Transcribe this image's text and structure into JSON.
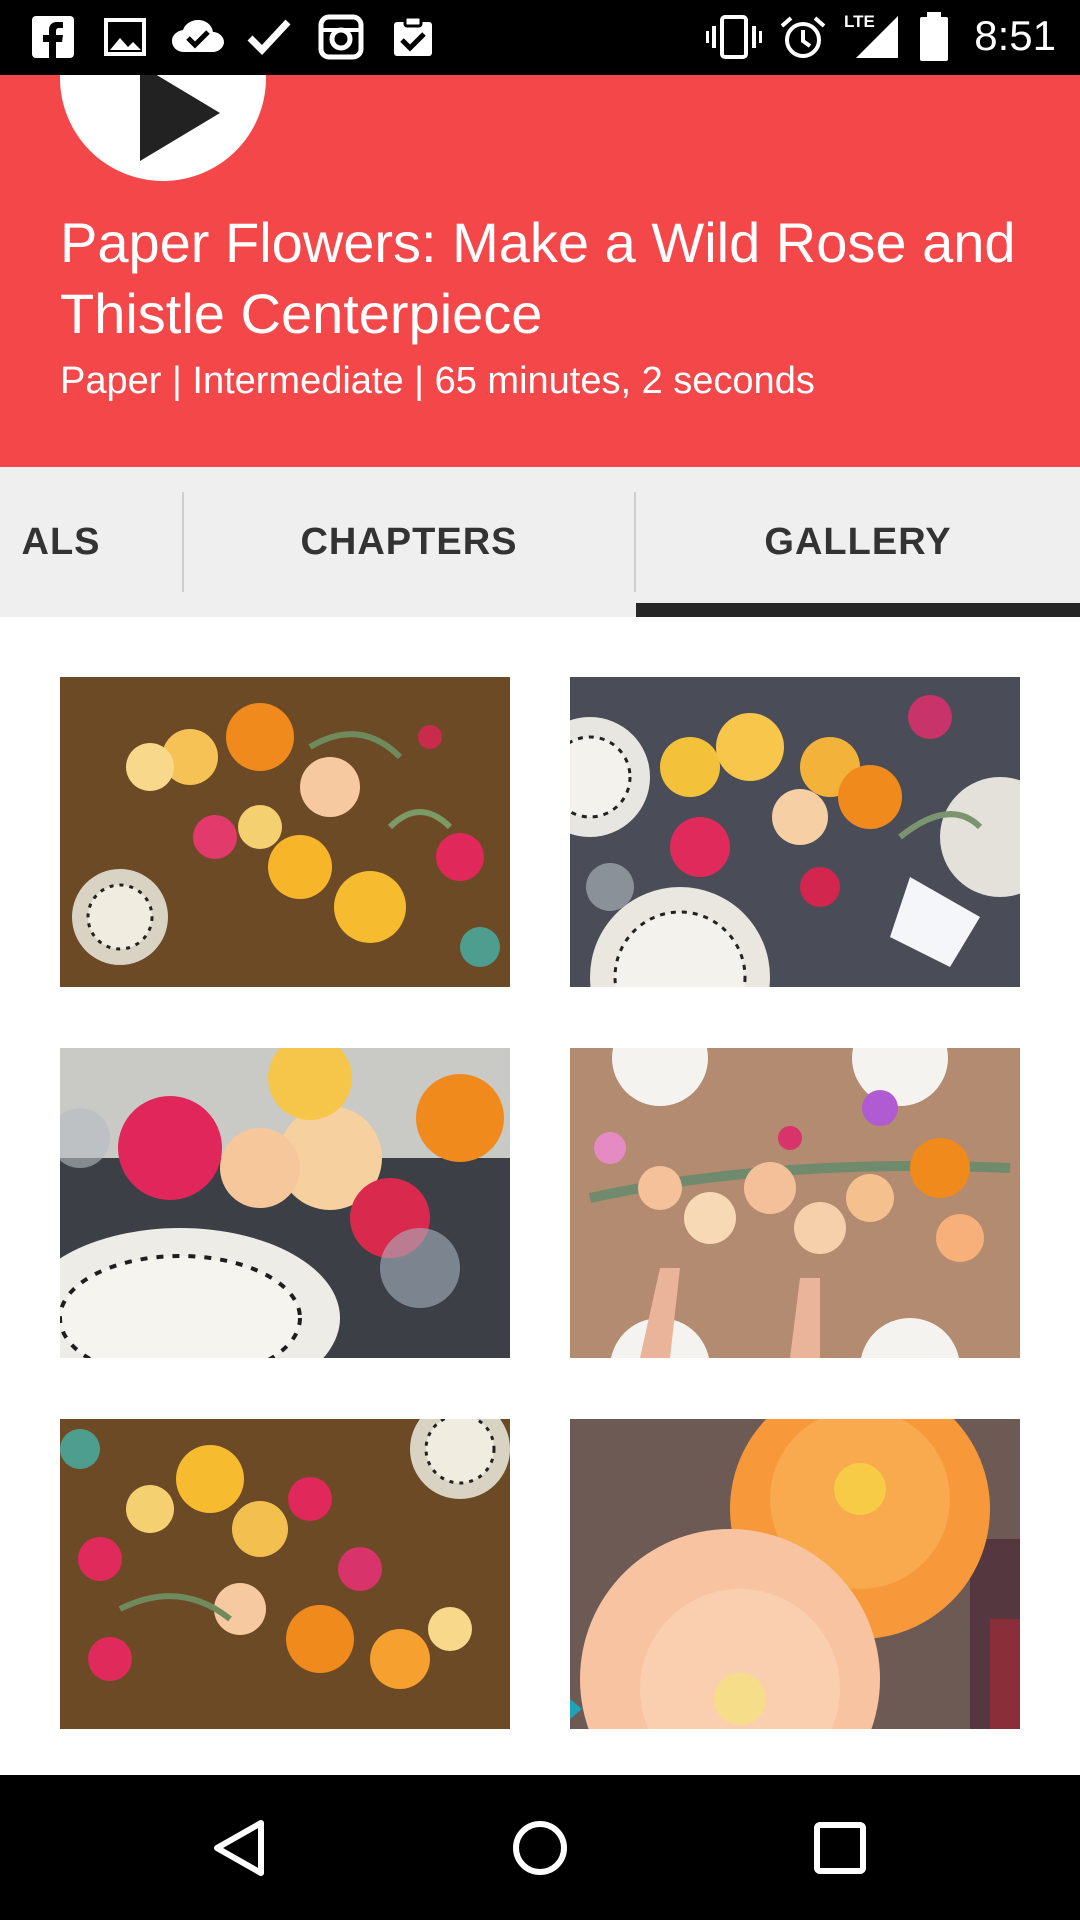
{
  "status_bar": {
    "time": "8:51",
    "left_icons": [
      "facebook-icon",
      "image-icon",
      "cloud-check-icon",
      "check-icon",
      "instagram-icon",
      "clipboard-check-icon"
    ],
    "right_icons": [
      "vibrate-icon",
      "alarm-icon",
      "lte-signal-icon",
      "battery-icon"
    ],
    "network_label": "LTE"
  },
  "header": {
    "title": "Paper Flowers: Make a Wild Rose and Thistle Centerpiece",
    "meta": "Paper | Intermediate | 65 minutes, 2 seconds",
    "background_color": "#f4474a"
  },
  "tabs": [
    {
      "label": "ALS"
    },
    {
      "label": "CHAPTERS"
    },
    {
      "label": "GALLERY",
      "selected": true
    }
  ],
  "gallery": {
    "images": [
      {
        "icon": "flower-photo-1"
      },
      {
        "icon": "flower-photo-2"
      },
      {
        "icon": "flower-photo-3"
      },
      {
        "icon": "flower-photo-4"
      },
      {
        "icon": "flower-photo-5"
      },
      {
        "icon": "flower-photo-6"
      }
    ]
  },
  "nav_bar": {
    "buttons": [
      "back-icon",
      "home-icon",
      "recents-icon"
    ]
  }
}
